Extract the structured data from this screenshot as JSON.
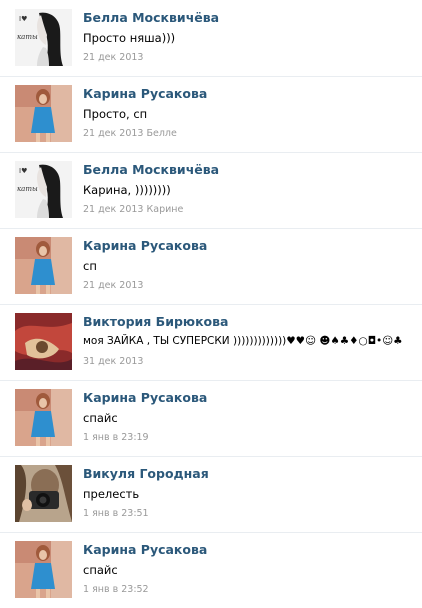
{
  "comments": [
    {
      "author": "Белла Москвичёва",
      "text": "Просто няша)))",
      "date": "21 дек 2013",
      "reply_to": "",
      "avatar_icon": "girl-sketch-avatar"
    },
    {
      "author": "Карина Русакова",
      "text": "Просто, сп",
      "date": "21 дек 2013",
      "reply_to": "Белле",
      "avatar_icon": "girl-blue-dress-avatar"
    },
    {
      "author": "Белла Москвичёва",
      "text": "Карина, ))))))))",
      "date": "21 дек 2013",
      "reply_to": "Карине",
      "avatar_icon": "girl-sketch-avatar"
    },
    {
      "author": "Карина Русакова",
      "text": "сп",
      "date": "21 дек 2013",
      "reply_to": "",
      "avatar_icon": "girl-blue-dress-avatar"
    },
    {
      "author": "Виктория Бирюкова",
      "text": "моя ЗАЙКА , ТЫ СУПЕРСКИ )))))))))))))♥♥☺ ☻♠♣♦○◘•☺♣",
      "date": "31 дек 2013",
      "reply_to": "",
      "avatar_icon": "red-blanket-avatar"
    },
    {
      "author": "Карина Русакова",
      "text": "спайс",
      "date": "1 янв в 23:19",
      "reply_to": "",
      "avatar_icon": "girl-blue-dress-avatar"
    },
    {
      "author": "Викуля Городная",
      "text": "прелесть",
      "date": "1 янв в 23:51",
      "reply_to": "",
      "avatar_icon": "camera-selfie-avatar"
    },
    {
      "author": "Карина Русакова",
      "text": "спайс",
      "date": "1 янв в 23:52",
      "reply_to": "",
      "avatar_icon": "girl-blue-dress-avatar"
    }
  ],
  "colors": {
    "author_link": "#2b587a",
    "meta_gray": "#999999",
    "divider": "#e9edf1"
  }
}
